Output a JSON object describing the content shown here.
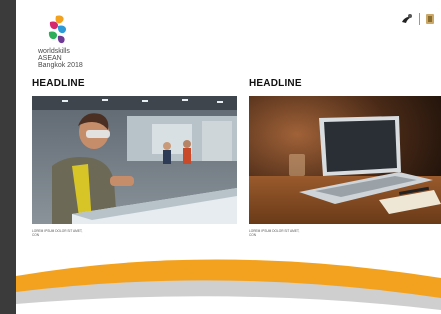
{
  "logo": {
    "line1": "worldskills",
    "line2": "ASEAN",
    "line3": "Bangkok 2018"
  },
  "articles": [
    {
      "headline": "HEADLINE",
      "caption_line1": "LOREM IPSUM DOLOR SIT AMET,",
      "caption_line2": "CON"
    },
    {
      "headline": "HEADLINE",
      "caption_line1": "LOREM IPSUM DOLOR SIT AMET,",
      "caption_line2": "CON"
    }
  ],
  "colors": {
    "accent_orange": "#f3a21f",
    "accent_gray": "#cfcfcf"
  }
}
